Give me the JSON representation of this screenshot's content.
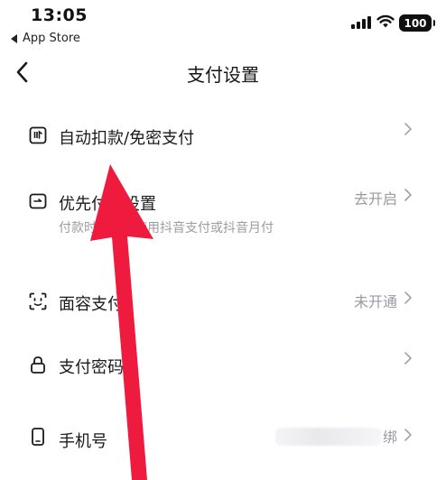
{
  "status_bar": {
    "time": "13:05",
    "back_app_label": "App Store",
    "battery_level": "100"
  },
  "nav": {
    "title": "支付设置"
  },
  "rows": [
    {
      "label": "自动扣款/免密支付",
      "value": "",
      "icon": "auto-debit-icon"
    },
    {
      "label": "优先付款设置",
      "subtitle": "付款时，优先使用抖音支付或抖音月付",
      "value": "去开启",
      "icon": "priority-payment-icon"
    },
    {
      "label": "面容支付",
      "value": "未开通",
      "icon": "face-id-icon"
    },
    {
      "label": "支付密码",
      "value": "",
      "icon": "lock-icon"
    },
    {
      "label": "手机号",
      "value": "绑",
      "icon": "phone-icon"
    }
  ],
  "colors": {
    "arrow": "#ee1b3f",
    "secondary_text": "#9a9aa2",
    "primary_text": "#1a1a1a"
  }
}
